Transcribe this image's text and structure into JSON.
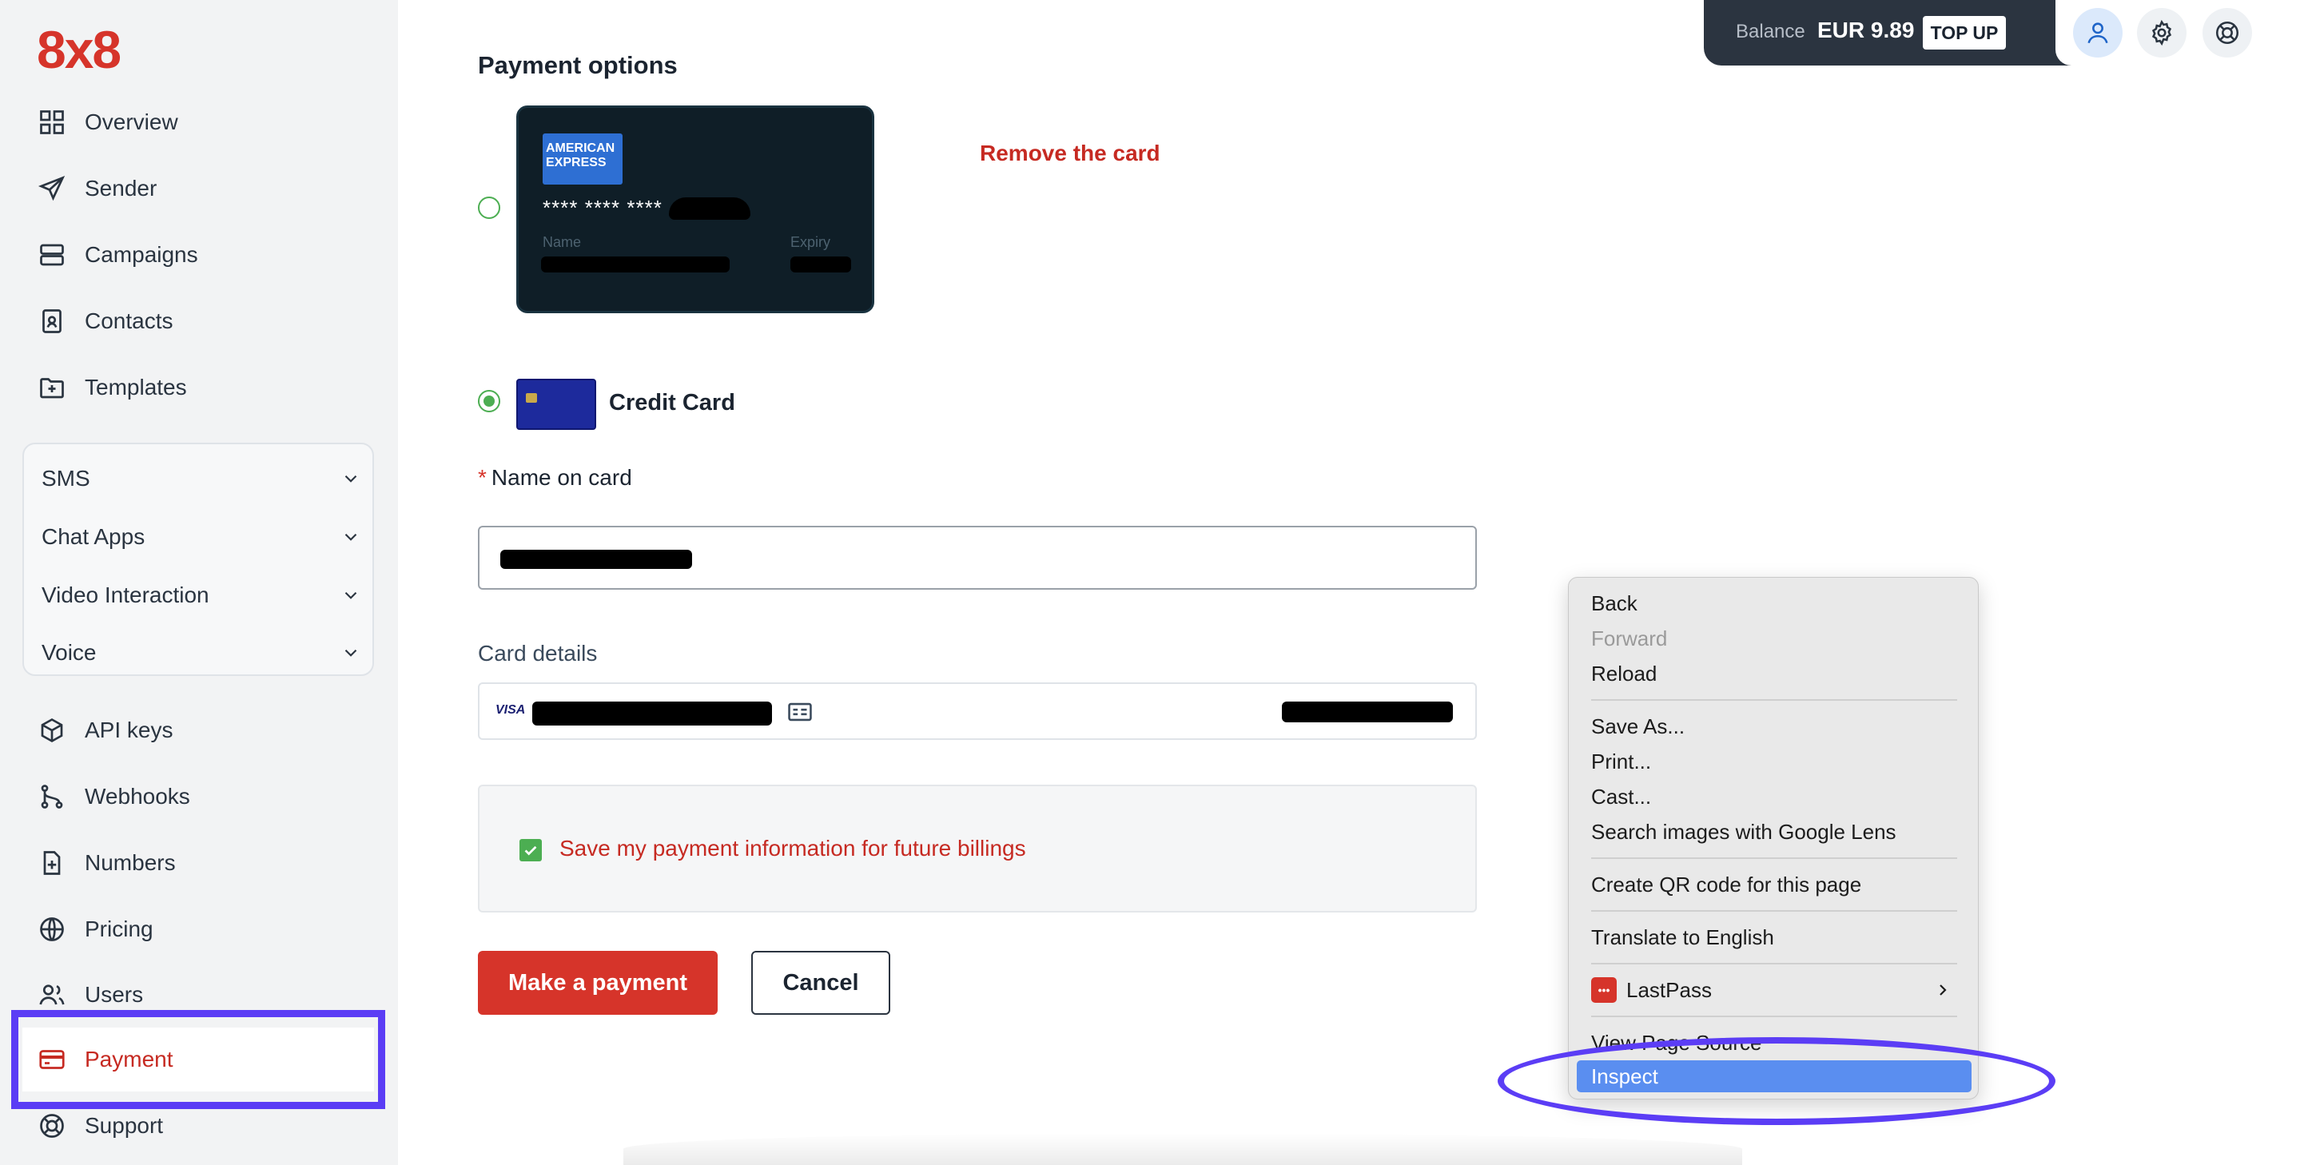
{
  "brand": {
    "logo_text": "8x8",
    "accent": "#d6342a"
  },
  "sidebar": {
    "items": [
      {
        "label": "Overview",
        "icon": "grid-icon"
      },
      {
        "label": "Sender",
        "icon": "send-icon"
      },
      {
        "label": "Campaigns",
        "icon": "campaigns-icon"
      },
      {
        "label": "Contacts",
        "icon": "contacts-icon"
      },
      {
        "label": "Templates",
        "icon": "templates-icon"
      }
    ],
    "groups": [
      {
        "label": "SMS"
      },
      {
        "label": "Chat Apps"
      },
      {
        "label": "Video Interaction"
      },
      {
        "label": "Voice"
      }
    ],
    "bottom_items": [
      {
        "label": "API keys",
        "icon": "cube-icon"
      },
      {
        "label": "Webhooks",
        "icon": "webhooks-icon"
      },
      {
        "label": "Numbers",
        "icon": "numbers-icon"
      },
      {
        "label": "Pricing",
        "icon": "globe-icon"
      },
      {
        "label": "Users",
        "icon": "users-icon"
      },
      {
        "label": "Payment",
        "icon": "credit-card-icon",
        "active": true
      },
      {
        "label": "Support",
        "icon": "lifebuoy-icon"
      }
    ]
  },
  "header": {
    "balance_label": "Balance",
    "balance_value": "EUR 9.89",
    "topup_label": "TOP UP"
  },
  "payment": {
    "title": "Payment options",
    "saved_card": {
      "brand_text": "AMERICAN EXPRESS",
      "number_masked": "**** **** ****",
      "name_label": "Name",
      "expiry_label": "Expiry"
    },
    "remove_card_label": "Remove the card",
    "credit_card_label": "Credit Card",
    "name_on_card_label": "Name on card",
    "required_mark": "*",
    "card_details_label": "Card details",
    "visa_label": "VISA",
    "save_info_label": "Save my payment information for future billings",
    "make_payment_label": "Make a payment",
    "cancel_label": "Cancel"
  },
  "context_menu": {
    "items": [
      {
        "label": "Back"
      },
      {
        "label": "Forward",
        "disabled": true
      },
      {
        "label": "Reload"
      },
      {
        "label": "Save As..."
      },
      {
        "label": "Print..."
      },
      {
        "label": "Cast..."
      },
      {
        "label": "Search images with Google Lens"
      },
      {
        "label": "Create QR code for this page"
      },
      {
        "label": "Translate to English"
      },
      {
        "label": "LastPass"
      },
      {
        "label": "View Page Source"
      },
      {
        "label": "Inspect",
        "highlighted": true
      }
    ]
  },
  "annotation_color": "#5b3df5"
}
